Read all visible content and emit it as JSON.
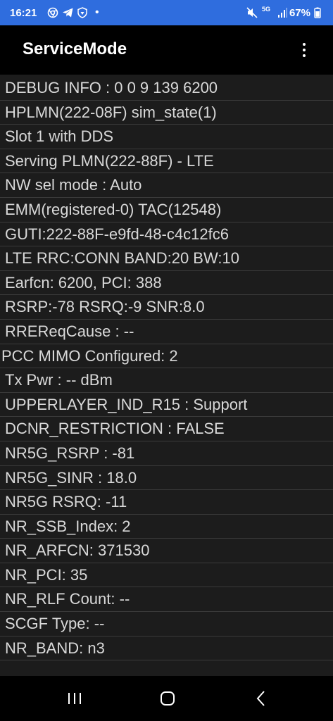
{
  "status_bar": {
    "time": "16:21",
    "icons_left": [
      "chrome-icon",
      "telegram-icon",
      "shield-icon",
      "notification-dot"
    ],
    "icons_right": [
      "mute-icon",
      "5g-icon",
      "signal-icon"
    ],
    "network_label": "5G",
    "battery": "67%",
    "background_color": "#2f6dde"
  },
  "app_bar": {
    "title": "ServiceMode",
    "menu_icon": "more-vert-icon"
  },
  "rows": [
    "DEBUG INFO : 0 0 9 139 6200",
    "HPLMN(222-08F) sim_state(1)",
    "Slot 1 with DDS",
    "Serving PLMN(222-88F) - LTE",
    "NW sel mode : Auto",
    "EMM(registered-0) TAC(12548)",
    "GUTI:222-88F-e9fd-48-c4c12fc6",
    "LTE RRC:CONN BAND:20 BW:10",
    "Earfcn: 6200, PCI: 388",
    "RSRP:-78 RSRQ:-9 SNR:8.0",
    "RREReqCause : --",
    "PCC MIMO Configured: 2",
    "Tx Pwr : -- dBm",
    "UPPERLAYER_IND_R15 : Support",
    "DCNR_RESTRICTION : FALSE",
    "NR5G_RSRP : -81",
    "NR5G_SINR : 18.0",
    "NR5G RSRQ: -11",
    "NR_SSB_Index: 2",
    "NR_ARFCN: 371530",
    "NR_PCI: 35",
    "NR_RLF Count: --",
    "SCGF Type: --",
    "NR_BAND: n3"
  ],
  "nav_bar": {
    "buttons": [
      "recent-apps-icon",
      "home-icon",
      "back-icon"
    ]
  }
}
